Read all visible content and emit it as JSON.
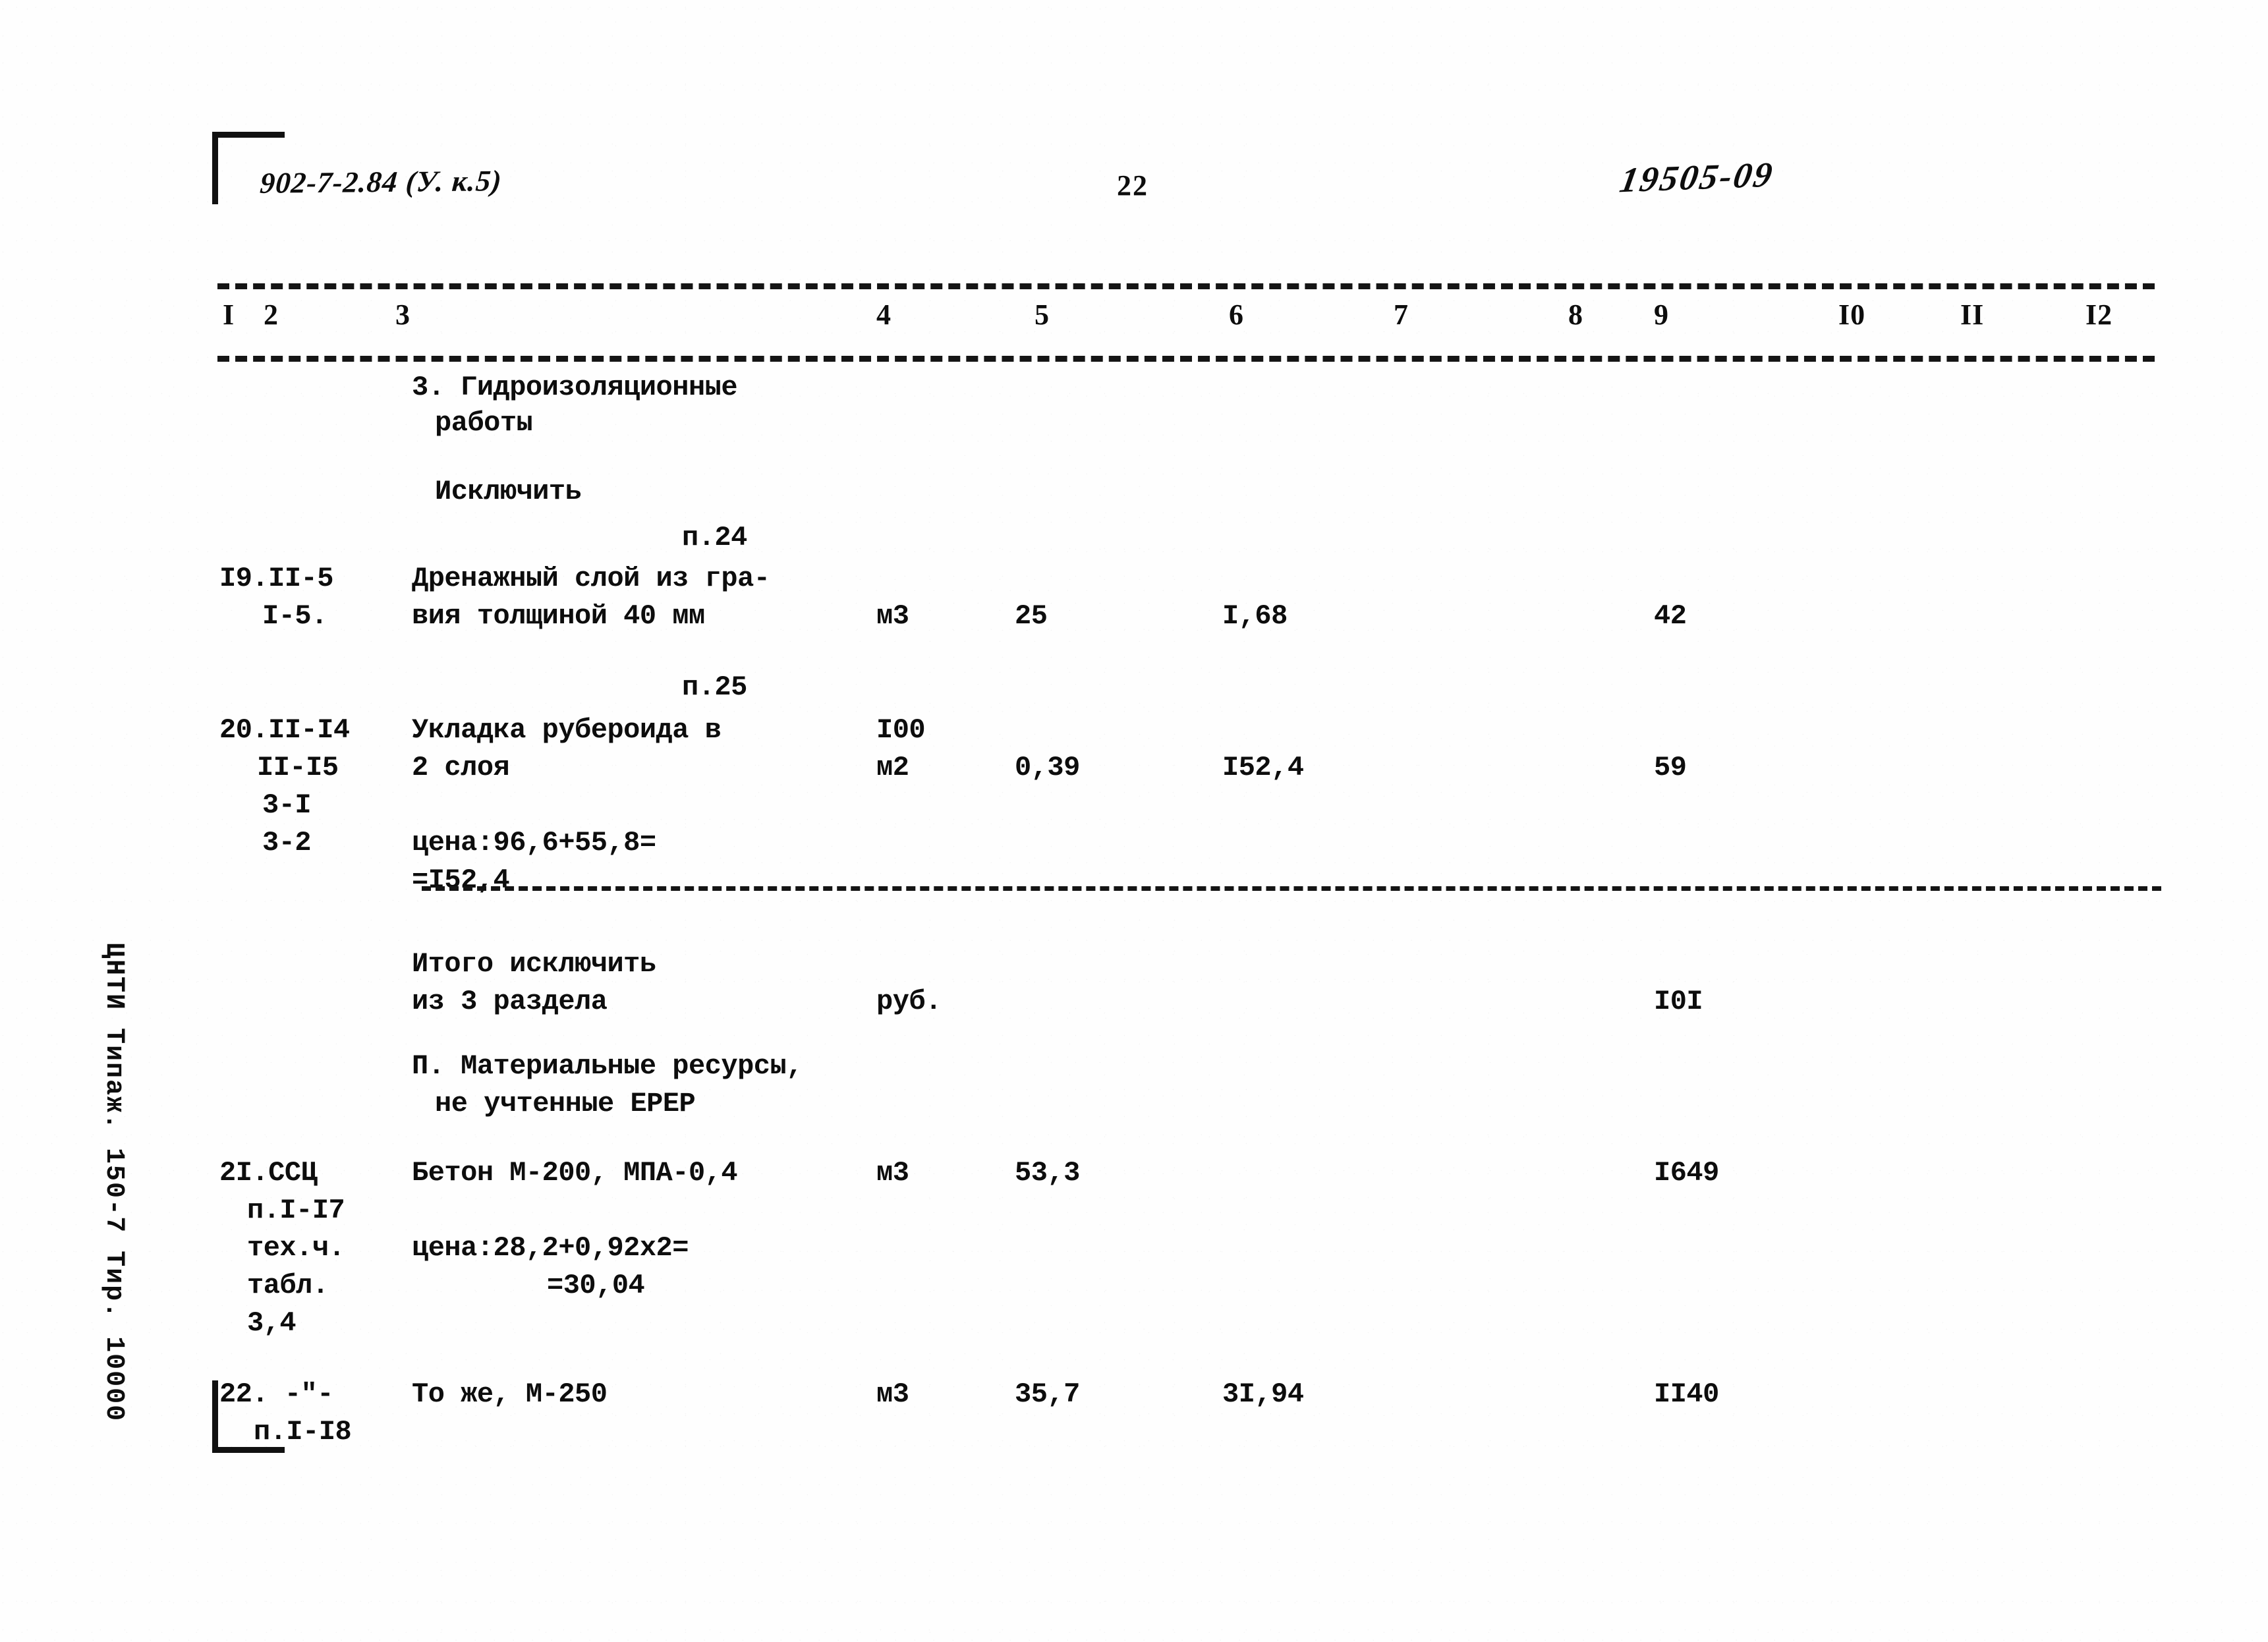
{
  "header": {
    "document_code": "902-7-2.84 (У. к.5)",
    "page_number": "22",
    "archive_number": "19505-09"
  },
  "column_numbers": [
    "I",
    "2",
    "3",
    "4",
    "5",
    "6",
    "7",
    "8",
    "9",
    "I0",
    "II",
    "I2"
  ],
  "section_heading": {
    "line1": "3. Гидроизоляционные",
    "line2": "работы"
  },
  "exclude_label": "Исключить",
  "rows": [
    {
      "item_note": "п.24",
      "code_line1": "I9.II-5",
      "code_line2": "I-5.",
      "description_line1": "Дренажный слой из гра-",
      "description_line2": "вия толщиной 40 мм",
      "unit": "м3",
      "col5": "25",
      "col6": "I,68",
      "col9": "42"
    },
    {
      "item_note": "п.25",
      "code_line1": "20.II-I4",
      "code_line2": "II-I5",
      "code_line3": "3-I",
      "code_line4": "3-2",
      "description_line1": "Укладка рубероида в",
      "description_line2": "2 слоя",
      "price_formula_line1": "цена:96,6+55,8=",
      "price_formula_line2": "=I52,4",
      "unit_line1": "I00",
      "unit_line2": "м2",
      "col5": "0,39",
      "col6": "I52,4",
      "col9": "59"
    }
  ],
  "subtotal": {
    "label_line1": "Итого исключить",
    "label_line2": "из 3 раздела",
    "unit": "руб.",
    "col9": "I0I"
  },
  "section2_heading": {
    "line1": "П. Материальные ресурсы,",
    "line2": "не учтенные ЕРЕР"
  },
  "rows2": [
    {
      "code_line1": "2I.ССЦ",
      "code_line2": "п.I-I7",
      "code_line3": "тех.ч.",
      "code_line4": "табл.",
      "code_line5": "3,4",
      "description": "Бетон М-200, МПА-0,4",
      "price_formula_line1": "цена:28,2+0,92х2=",
      "price_formula_line2": "=30,04",
      "unit": "м3",
      "col5": "53,3",
      "col6": "",
      "col9": "I649"
    },
    {
      "code_line1": "22. -\"-",
      "code_line2": "п.I-I8",
      "description": "То же, М-250",
      "unit": "м3",
      "col5": "35,7",
      "col6": "3I,94",
      "col9": "II40"
    }
  ],
  "imprint": "ЦНТИ Типаж. 150-7 Тир. 10000"
}
